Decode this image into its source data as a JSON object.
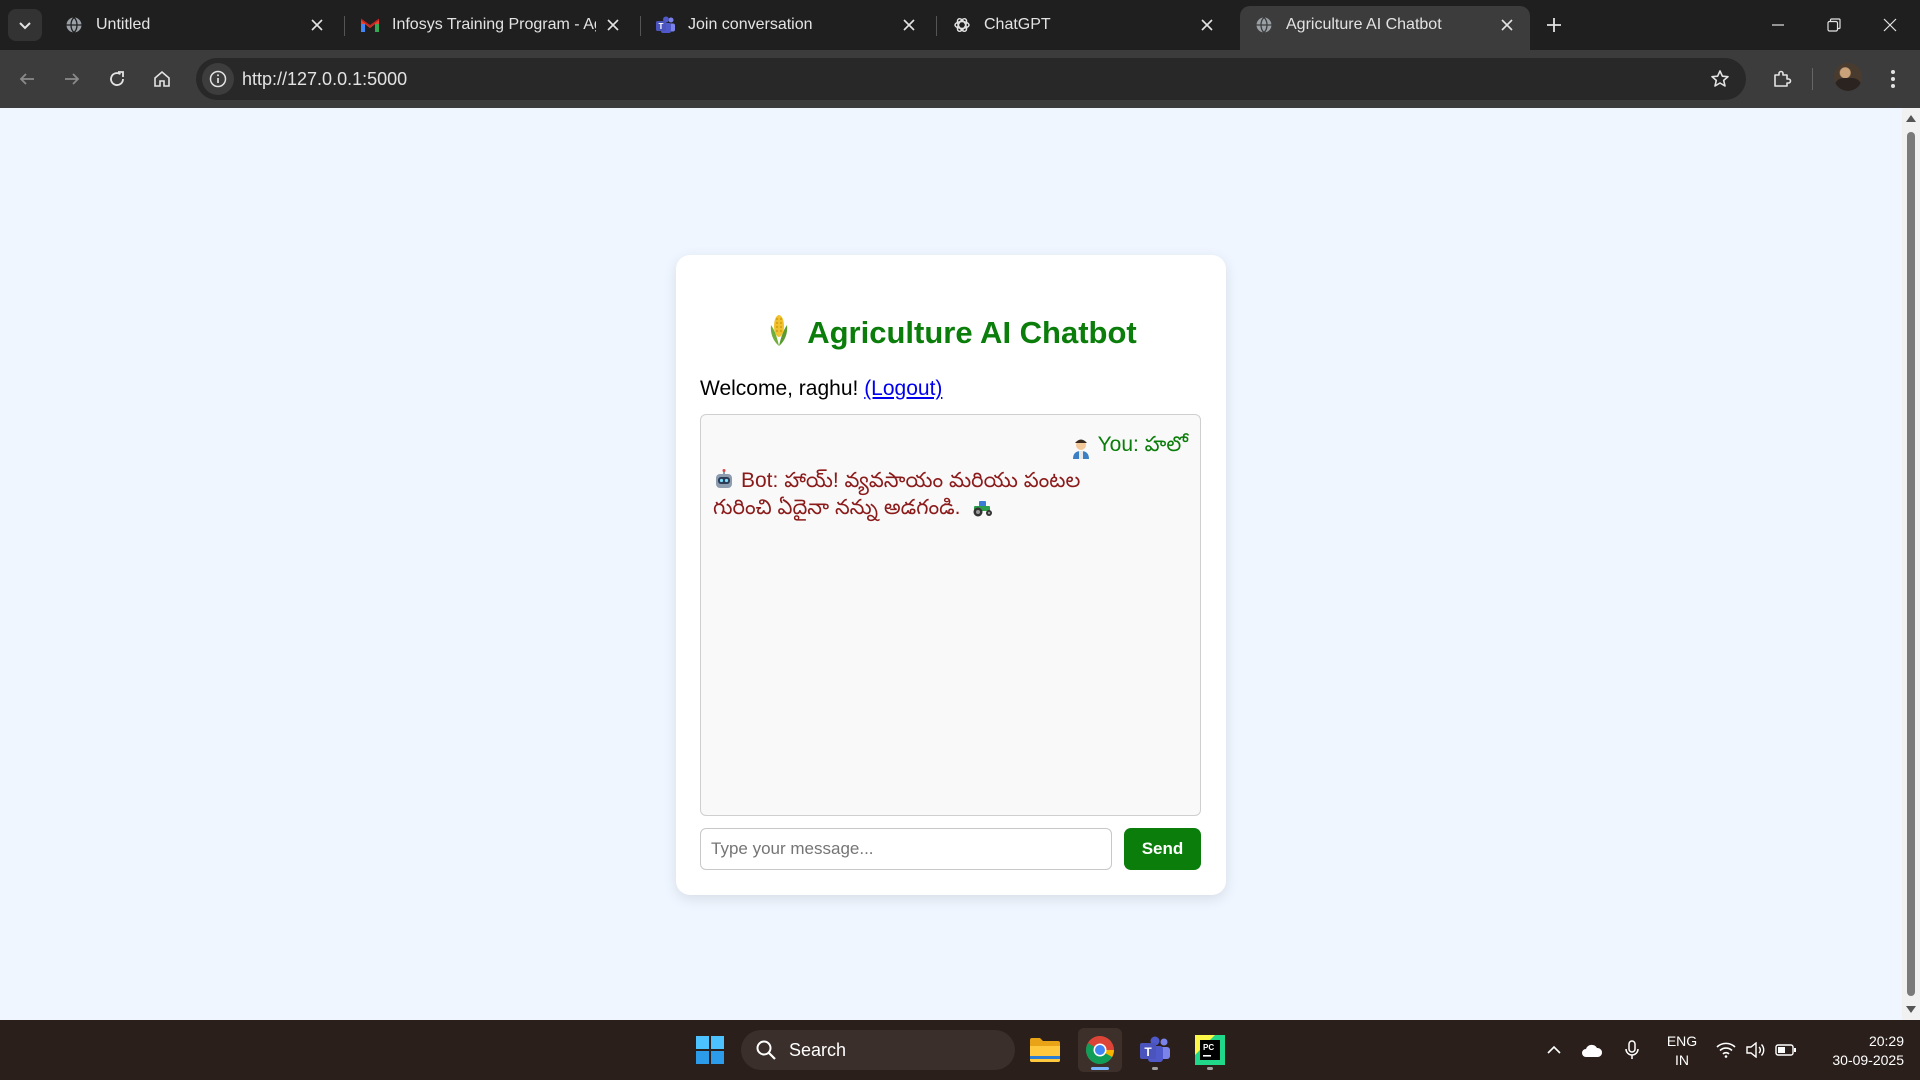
{
  "browser": {
    "tabs": [
      {
        "title": "Untitled",
        "icon": "globe-icon",
        "active": false
      },
      {
        "title": "Infosys Training Program - Agro",
        "icon": "gmail-icon",
        "active": false
      },
      {
        "title": "Join conversation",
        "icon": "teams-icon",
        "active": false
      },
      {
        "title": "ChatGPT",
        "icon": "chatgpt-icon",
        "active": false
      },
      {
        "title": "Agriculture AI Chatbot",
        "icon": "globe-icon",
        "active": true
      }
    ],
    "url": "http://127.0.0.1:5000"
  },
  "page": {
    "title": "Agriculture AI Chatbot",
    "welcome_text": "Welcome, raghu! ",
    "logout_label": "(Logout)",
    "messages": [
      {
        "sender": "user",
        "text": "You: హలో",
        "emoji": "farmer"
      },
      {
        "sender": "bot",
        "text": "Bot: హాయ్! వ్యవసాయం మరియు పంటల గురించి ఏదైనా నన్ను అడగండి.",
        "emoji": "robot",
        "trailing_emoji": "tractor"
      }
    ],
    "input_placeholder": "Type your message...",
    "send_label": "Send",
    "accent_color": "#0a7d0a",
    "bot_color": "#8b1a1a"
  },
  "taskbar": {
    "search_label": "Search",
    "apps": [
      "start-icon",
      "file-explorer-icon",
      "chrome-icon",
      "teams-icon",
      "pycharm-icon"
    ],
    "language": {
      "line1": "ENG",
      "line2": "IN"
    },
    "time": "20:29",
    "date": "30-09-2025"
  }
}
